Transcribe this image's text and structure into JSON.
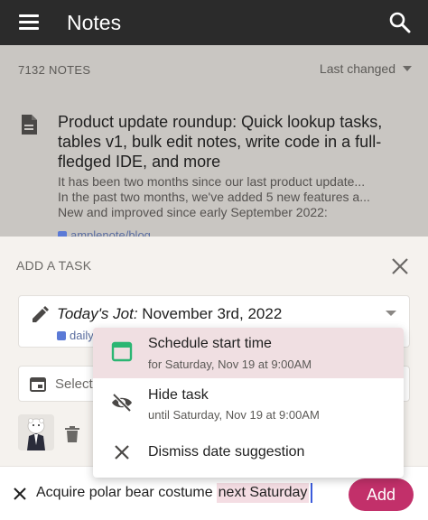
{
  "appbar": {
    "title": "Notes"
  },
  "notes_list": {
    "count_label": "7132 NOTES",
    "sort_label": "Last changed",
    "note": {
      "title": "Product update roundup: Quick lookup tasks, tables v1, bulk edit notes, write code in a full-fledged IDE, and more",
      "snippet_lines": [
        "It has been two months since our last product update...",
        "In the past two months, we've added 5 new features a...",
        "New and improved since early September 2022:"
      ],
      "tag": "amplenote/blog"
    }
  },
  "sheet": {
    "title": "ADD A TASK",
    "jot": {
      "label_italic": "Today's Jot:",
      "label_date": "November 3rd, 2022",
      "tag": "daily"
    },
    "date_placeholder": "Select"
  },
  "dropdown": {
    "items": [
      {
        "label": "Schedule start time",
        "sub": "for Saturday, Nov 19 at 9:00AM",
        "icon": "calendar-icon"
      },
      {
        "label": "Hide task",
        "sub": "until Saturday, Nov 19 at 9:00AM",
        "icon": "eye-off-icon"
      },
      {
        "label": "Dismiss date suggestion",
        "icon": "close-icon"
      }
    ]
  },
  "input_bar": {
    "text": "Acquire polar bear costume",
    "highlight": "next Saturday",
    "add_label": "Add"
  },
  "colors": {
    "appbar": "#2b2b2b",
    "accent": "#c2306a",
    "calendar_green": "#2bb673",
    "highlight": "#f4dde3"
  }
}
